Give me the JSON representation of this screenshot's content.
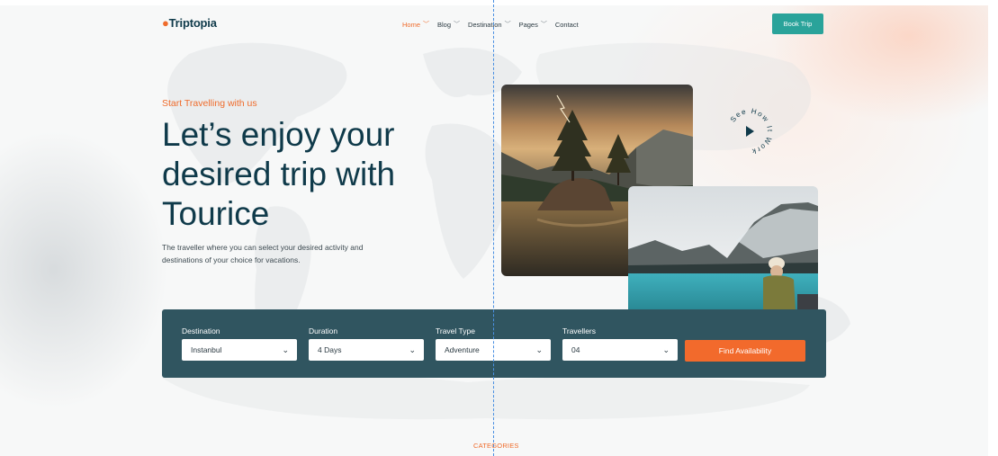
{
  "brand": {
    "logo_text": "Triptopia",
    "accent_color": "#ef6c2c",
    "teal_color": "#2aa39a",
    "navy_color": "#0f3a4a"
  },
  "nav": {
    "items": [
      {
        "label": "Home",
        "has_dropdown": true,
        "active": true
      },
      {
        "label": "Blog",
        "has_dropdown": true
      },
      {
        "label": "Destination",
        "has_dropdown": true
      },
      {
        "label": "Pages",
        "has_dropdown": true
      },
      {
        "label": "Contact",
        "has_dropdown": false
      }
    ],
    "cta_label": "Book Trip"
  },
  "hero": {
    "eyebrow": "Start Travelling with us",
    "headline_lines": [
      "Let’s enjoy your",
      "desired trip with",
      "Tourice"
    ],
    "description": "The traveller where you can select your desired activity and destinations of your choice for vacations.",
    "see_how_label": "See How It Work",
    "images": [
      "mountain-lake-lightning-photo",
      "woman-at-glacier-lake-photo"
    ]
  },
  "search": {
    "fields": [
      {
        "label": "Destination",
        "value": "Instanbul"
      },
      {
        "label": "Duration",
        "value": "4 Days"
      },
      {
        "label": "Travel Type",
        "value": "Adventure"
      },
      {
        "label": "Travellers",
        "value": "04"
      }
    ],
    "button_label": "Find Availability"
  },
  "section_label": "CATEGORIES"
}
